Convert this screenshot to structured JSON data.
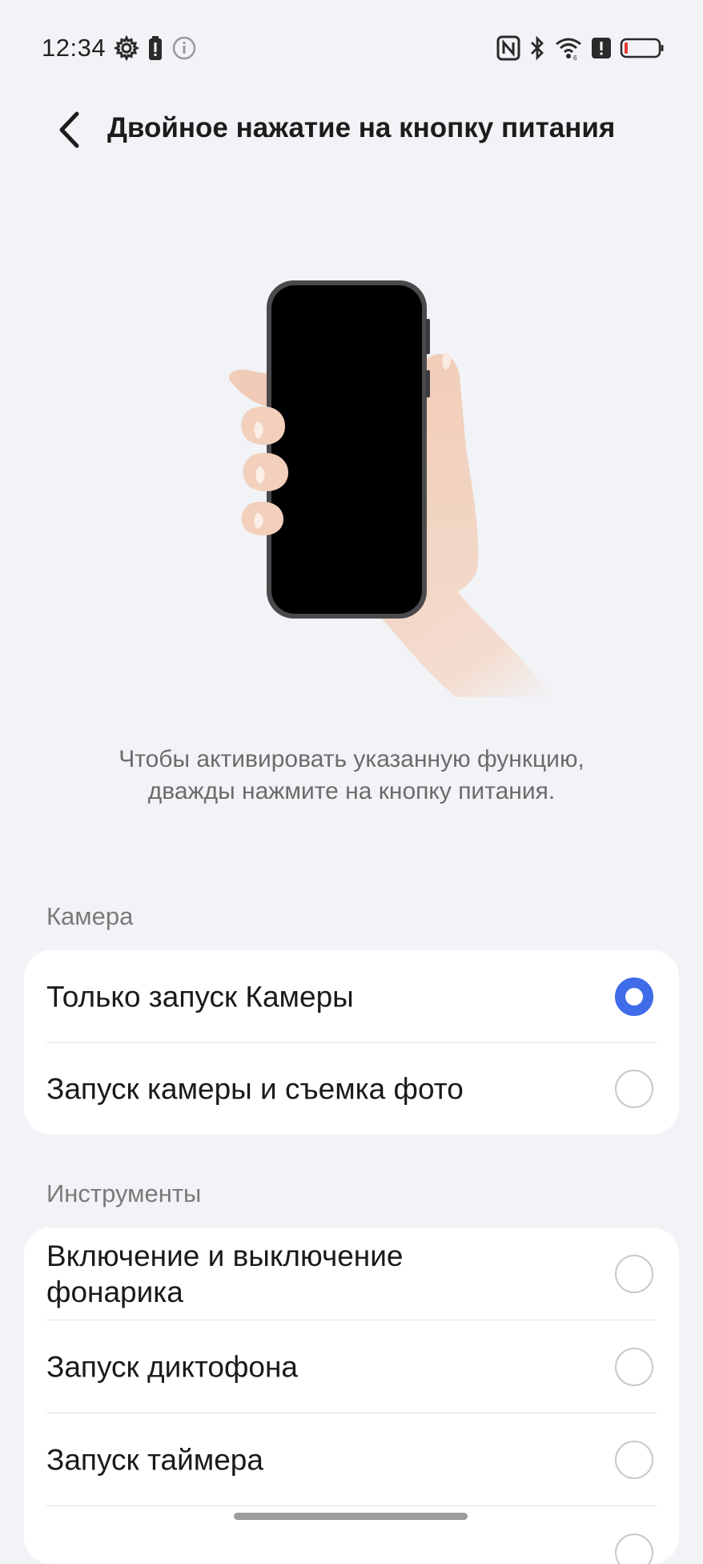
{
  "status_bar": {
    "time": "12:34",
    "left_icons": [
      "gear-icon",
      "battery-alert-icon",
      "info-icon"
    ],
    "right_icons": [
      "nfc-icon",
      "bluetooth-icon",
      "wifi-icon",
      "alert-icon",
      "battery-icon"
    ]
  },
  "header": {
    "title": "Двойное нажатие на кнопку питания",
    "back_icon": "chevron-left-icon"
  },
  "illustration": {
    "icon": "hand-holding-phone-illustration"
  },
  "description": {
    "line1": "Чтобы активировать указанную функцию,",
    "line2": "дважды нажмите на кнопку питания."
  },
  "sections": [
    {
      "label": "Камера",
      "options": [
        {
          "label": "Только запуск Камеры",
          "selected": true
        },
        {
          "label": "Запуск камеры и съемка фото",
          "selected": false
        }
      ]
    },
    {
      "label": "Инструменты",
      "options": [
        {
          "label": "Включение и выключение фонарика",
          "line1": "Включение и выключение",
          "line2": "фонарика",
          "selected": false
        },
        {
          "label": "Запуск диктофона",
          "selected": false
        },
        {
          "label": "Запуск таймера",
          "selected": false
        }
      ]
    }
  ],
  "colors": {
    "background": "#f1f3f6",
    "card": "#ffffff",
    "accent": "#3f6ce8",
    "battery_low": "#e53935"
  }
}
